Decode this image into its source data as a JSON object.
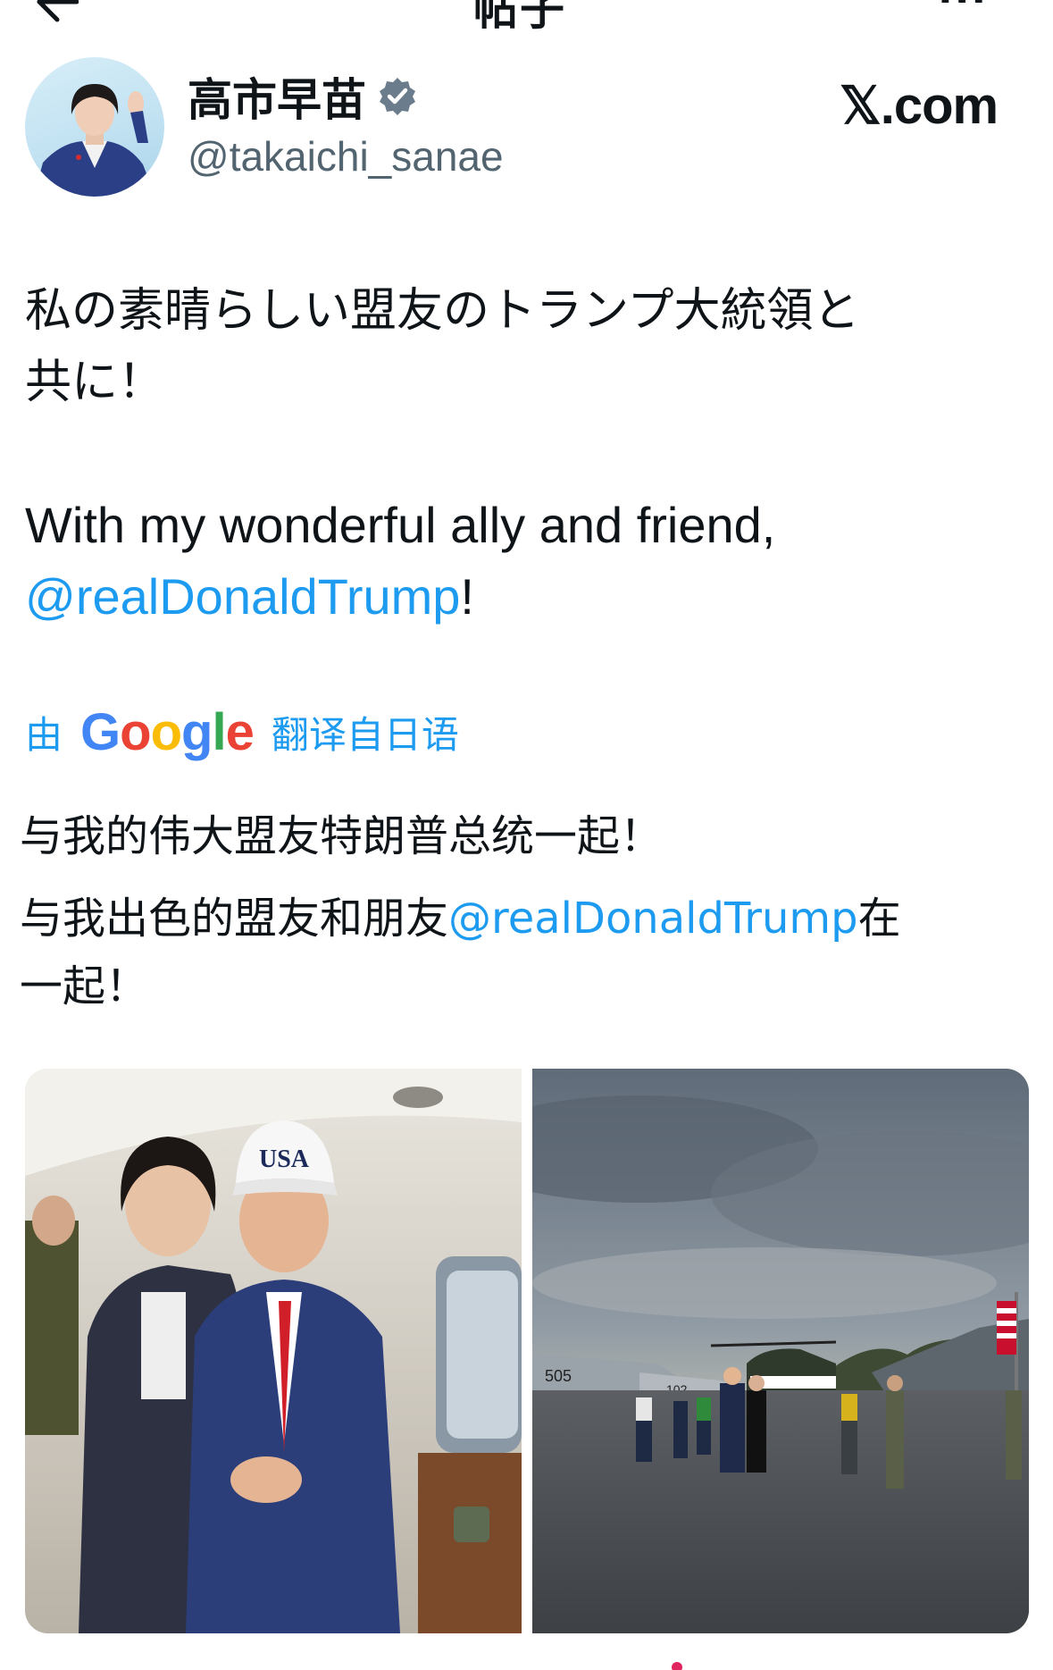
{
  "topbar": {
    "title": "帖子"
  },
  "post": {
    "display_name": "高市早苗",
    "handle": "@takaichi_sanae",
    "source_logo": "𝕏.com",
    "jp_line1": "私の素晴らしい盟友のトランプ大統領と",
    "jp_line2": "共に！",
    "en_line1": "With my wonderful ally and friend,",
    "en_mention": "@realDonaldTrump",
    "en_suffix": "!"
  },
  "translation": {
    "prefix": "由",
    "provider": "Google",
    "suffix": "翻译自日语",
    "line1": "与我的伟大盟友特朗普总统一起！",
    "line2_pre": "与我出色的盟友和朋友",
    "line2_mention": "@realDonaldTrump",
    "line2_post": "在",
    "line3": "一起！"
  },
  "media": {
    "left_cap_text": "USA",
    "right_jet_number": "505",
    "right_jet_number2": "102"
  },
  "colors": {
    "link": "#1d9bf0",
    "verified": "#6b7c8c",
    "text": "#0f1419"
  },
  "icons": [
    "back-arrow-icon",
    "more-icon",
    "verified-badge-icon",
    "x-logo"
  ]
}
